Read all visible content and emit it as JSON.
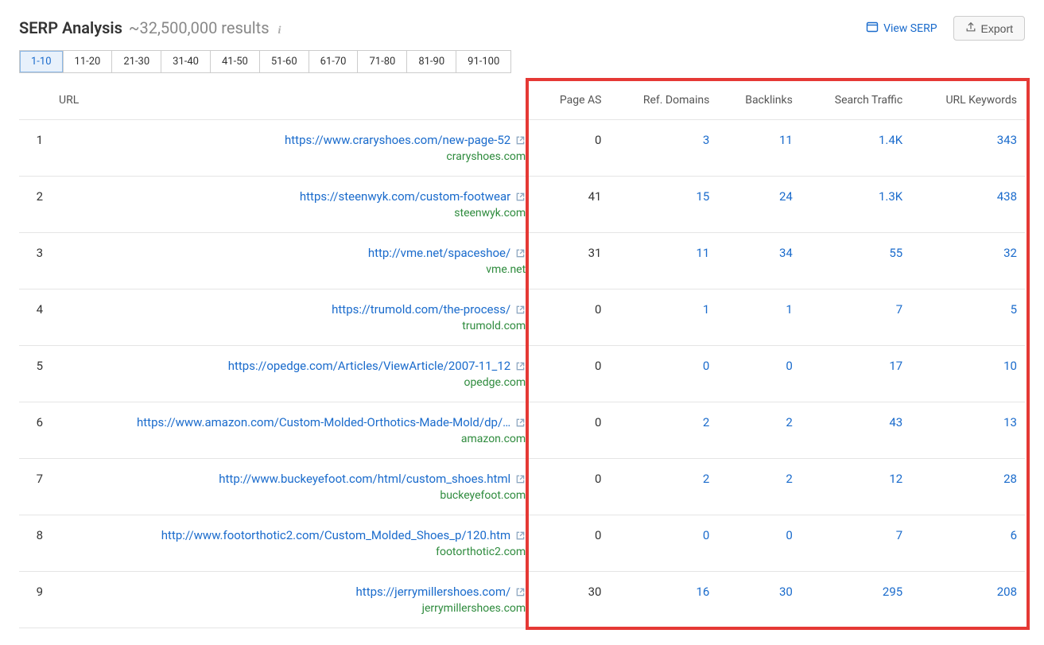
{
  "header": {
    "title": "SERP Analysis",
    "results_count": "~32,500,000 results",
    "view_serp_label": "View SERP",
    "export_label": "Export"
  },
  "tabs": [
    {
      "label": "1-10",
      "active": true
    },
    {
      "label": "11-20",
      "active": false
    },
    {
      "label": "21-30",
      "active": false
    },
    {
      "label": "31-40",
      "active": false
    },
    {
      "label": "41-50",
      "active": false
    },
    {
      "label": "51-60",
      "active": false
    },
    {
      "label": "61-70",
      "active": false
    },
    {
      "label": "71-80",
      "active": false
    },
    {
      "label": "81-90",
      "active": false
    },
    {
      "label": "91-100",
      "active": false
    }
  ],
  "columns": {
    "url": "URL",
    "page_as": "Page AS",
    "ref_domains": "Ref. Domains",
    "backlinks": "Backlinks",
    "search_traffic": "Search Traffic",
    "url_keywords": "URL Keywords"
  },
  "rows": [
    {
      "rank": "1",
      "url": "https://www.craryshoes.com/new-page-52",
      "domain": "craryshoes.com",
      "page_as": "0",
      "ref_domains": "3",
      "backlinks": "11",
      "search_traffic": "1.4K",
      "url_keywords": "343"
    },
    {
      "rank": "2",
      "url": "https://steenwyk.com/custom-footwear",
      "domain": "steenwyk.com",
      "page_as": "41",
      "ref_domains": "15",
      "backlinks": "24",
      "search_traffic": "1.3K",
      "url_keywords": "438"
    },
    {
      "rank": "3",
      "url": "http://vme.net/spaceshoe/",
      "domain": "vme.net",
      "page_as": "31",
      "ref_domains": "11",
      "backlinks": "34",
      "search_traffic": "55",
      "url_keywords": "32"
    },
    {
      "rank": "4",
      "url": "https://trumold.com/the-process/",
      "domain": "trumold.com",
      "page_as": "0",
      "ref_domains": "1",
      "backlinks": "1",
      "search_traffic": "7",
      "url_keywords": "5"
    },
    {
      "rank": "5",
      "url": "https://opedge.com/Articles/ViewArticle/2007-11_12",
      "domain": "opedge.com",
      "page_as": "0",
      "ref_domains": "0",
      "backlinks": "0",
      "search_traffic": "17",
      "url_keywords": "10"
    },
    {
      "rank": "6",
      "url": "https://www.amazon.com/Custom-Molded-Orthotics-Made-Mold/dp/…",
      "domain": "amazon.com",
      "page_as": "0",
      "ref_domains": "2",
      "backlinks": "2",
      "search_traffic": "43",
      "url_keywords": "13"
    },
    {
      "rank": "7",
      "url": "http://www.buckeyefoot.com/html/custom_shoes.html",
      "domain": "buckeyefoot.com",
      "page_as": "0",
      "ref_domains": "2",
      "backlinks": "2",
      "search_traffic": "12",
      "url_keywords": "28"
    },
    {
      "rank": "8",
      "url": "http://www.footorthotic2.com/Custom_Molded_Shoes_p/120.htm",
      "domain": "footorthotic2.com",
      "page_as": "0",
      "ref_domains": "0",
      "backlinks": "0",
      "search_traffic": "7",
      "url_keywords": "6"
    },
    {
      "rank": "9",
      "url": "https://jerrymillershoes.com/",
      "domain": "jerrymillershoes.com",
      "page_as": "30",
      "ref_domains": "16",
      "backlinks": "30",
      "search_traffic": "295",
      "url_keywords": "208"
    }
  ]
}
